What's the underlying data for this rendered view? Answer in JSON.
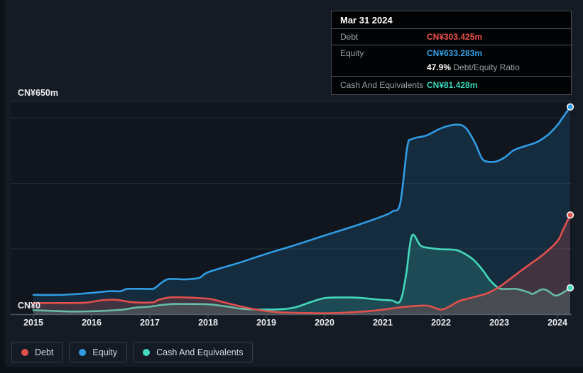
{
  "tooltip": {
    "date": "Mar 31 2024",
    "rows": [
      {
        "label": "Debt",
        "value": "CN¥303.425m",
        "color": "#ef4f4c"
      },
      {
        "label": "Equity",
        "value": "CN¥633.283m",
        "color": "#35a1ea"
      },
      {
        "label": "Cash And Equivalents",
        "value": "CN¥81.428m",
        "color": "#3bd8ba"
      }
    ],
    "ratio_value": "47.9%",
    "ratio_label": "Debt/Equity Ratio"
  },
  "legend": {
    "items": [
      {
        "label": "Debt",
        "color": "#e2504c"
      },
      {
        "label": "Equity",
        "color": "#2f9ce4"
      },
      {
        "label": "Cash And Equivalents",
        "color": "#43d9be"
      }
    ]
  },
  "chart_data": {
    "type": "area",
    "unit": "CN¥m",
    "xlim": [
      2015,
      2024.3
    ],
    "ylim": [
      0,
      650
    ],
    "grid": "horizontal",
    "legend_position": "bottom",
    "y_axis": {
      "top_label": "CN¥650m",
      "zero_label": "CN¥0",
      "gridline_values": [
        650,
        600,
        400,
        200,
        0
      ]
    },
    "x_ticks": [
      "2015",
      "2016",
      "2017",
      "2018",
      "2019",
      "2020",
      "2021",
      "2022",
      "2023",
      "2024"
    ],
    "series": [
      {
        "name": "Equity",
        "color": "#2f9ce4",
        "fill": "rgba(46,156,228,0.16)",
        "points": [
          [
            2015,
            60
          ],
          [
            2015.5,
            60
          ],
          [
            2016,
            66
          ],
          [
            2016.3,
            71
          ],
          [
            2016.5,
            71
          ],
          [
            2016.62,
            78
          ],
          [
            2017,
            78
          ],
          [
            2017.08,
            80
          ],
          [
            2017.3,
            107
          ],
          [
            2017.6,
            107
          ],
          [
            2017.85,
            112
          ],
          [
            2018,
            129
          ],
          [
            2018.5,
            156
          ],
          [
            2019,
            185
          ],
          [
            2019.5,
            212
          ],
          [
            2020,
            241
          ],
          [
            2020.5,
            269
          ],
          [
            2021,
            300
          ],
          [
            2021.17,
            315
          ],
          [
            2021.3,
            339
          ],
          [
            2021.42,
            510
          ],
          [
            2021.5,
            535
          ],
          [
            2021.75,
            546
          ],
          [
            2022,
            568
          ],
          [
            2022.25,
            579
          ],
          [
            2022.42,
            570
          ],
          [
            2022.58,
            525
          ],
          [
            2022.7,
            477
          ],
          [
            2022.8,
            466
          ],
          [
            2022.95,
            467
          ],
          [
            2023.1,
            480
          ],
          [
            2023.25,
            501
          ],
          [
            2023.45,
            514
          ],
          [
            2023.65,
            526
          ],
          [
            2023.85,
            550
          ],
          [
            2024,
            578
          ],
          [
            2024.1,
            603
          ],
          [
            2024.22,
            633.283
          ]
        ]
      },
      {
        "name": "Cash And Equivalents",
        "color": "#43d9be",
        "fill": "rgba(67,217,190,0.18)",
        "points": [
          [
            2015,
            13
          ],
          [
            2015.35,
            11
          ],
          [
            2015.7,
            9
          ],
          [
            2016,
            10
          ],
          [
            2016.3,
            12
          ],
          [
            2016.55,
            15
          ],
          [
            2016.75,
            21
          ],
          [
            2017,
            24
          ],
          [
            2017.2,
            29
          ],
          [
            2017.4,
            32
          ],
          [
            2017.65,
            32
          ],
          [
            2018,
            31
          ],
          [
            2018.3,
            25
          ],
          [
            2018.6,
            17
          ],
          [
            2018.95,
            15
          ],
          [
            2019.25,
            16
          ],
          [
            2019.5,
            22
          ],
          [
            2019.75,
            37
          ],
          [
            2020,
            50
          ],
          [
            2020.3,
            52
          ],
          [
            2020.6,
            51
          ],
          [
            2020.9,
            46
          ],
          [
            2021.15,
            43
          ],
          [
            2021.3,
            41
          ],
          [
            2021.4,
            120
          ],
          [
            2021.5,
            240
          ],
          [
            2021.65,
            210
          ],
          [
            2021.8,
            203
          ],
          [
            2022,
            199
          ],
          [
            2022.25,
            197
          ],
          [
            2022.4,
            186
          ],
          [
            2022.55,
            168
          ],
          [
            2022.7,
            139
          ],
          [
            2022.85,
            103
          ],
          [
            2023,
            80
          ],
          [
            2023.15,
            78
          ],
          [
            2023.3,
            78
          ],
          [
            2023.5,
            68
          ],
          [
            2023.58,
            63
          ],
          [
            2023.72,
            76
          ],
          [
            2023.82,
            74
          ],
          [
            2023.96,
            58
          ],
          [
            2024.08,
            65
          ],
          [
            2024.22,
            81.428
          ]
        ]
      },
      {
        "name": "Debt",
        "color": "#e2504c",
        "fill": "rgba(226,80,76,0.22)",
        "points": [
          [
            2015,
            35
          ],
          [
            2015.5,
            35
          ],
          [
            2015.9,
            36
          ],
          [
            2016.15,
            43
          ],
          [
            2016.4,
            45
          ],
          [
            2016.6,
            40
          ],
          [
            2016.75,
            37
          ],
          [
            2017.05,
            37
          ],
          [
            2017.15,
            45
          ],
          [
            2017.35,
            52
          ],
          [
            2017.6,
            52
          ],
          [
            2017.85,
            50
          ],
          [
            2018.05,
            47
          ],
          [
            2018.3,
            36
          ],
          [
            2018.6,
            23
          ],
          [
            2018.9,
            13
          ],
          [
            2019.2,
            7
          ],
          [
            2019.6,
            5
          ],
          [
            2020,
            4
          ],
          [
            2020.4,
            6
          ],
          [
            2020.8,
            11
          ],
          [
            2021.1,
            17
          ],
          [
            2021.4,
            24
          ],
          [
            2021.65,
            27
          ],
          [
            2021.8,
            26
          ],
          [
            2022,
            15
          ],
          [
            2022.15,
            25
          ],
          [
            2022.3,
            40
          ],
          [
            2022.5,
            50
          ],
          [
            2022.65,
            57
          ],
          [
            2022.8,
            65
          ],
          [
            2023,
            84
          ],
          [
            2023.25,
            117
          ],
          [
            2023.5,
            150
          ],
          [
            2023.75,
            182
          ],
          [
            2024,
            224
          ],
          [
            2024.1,
            260
          ],
          [
            2024.22,
            303.425
          ]
        ]
      }
    ]
  }
}
